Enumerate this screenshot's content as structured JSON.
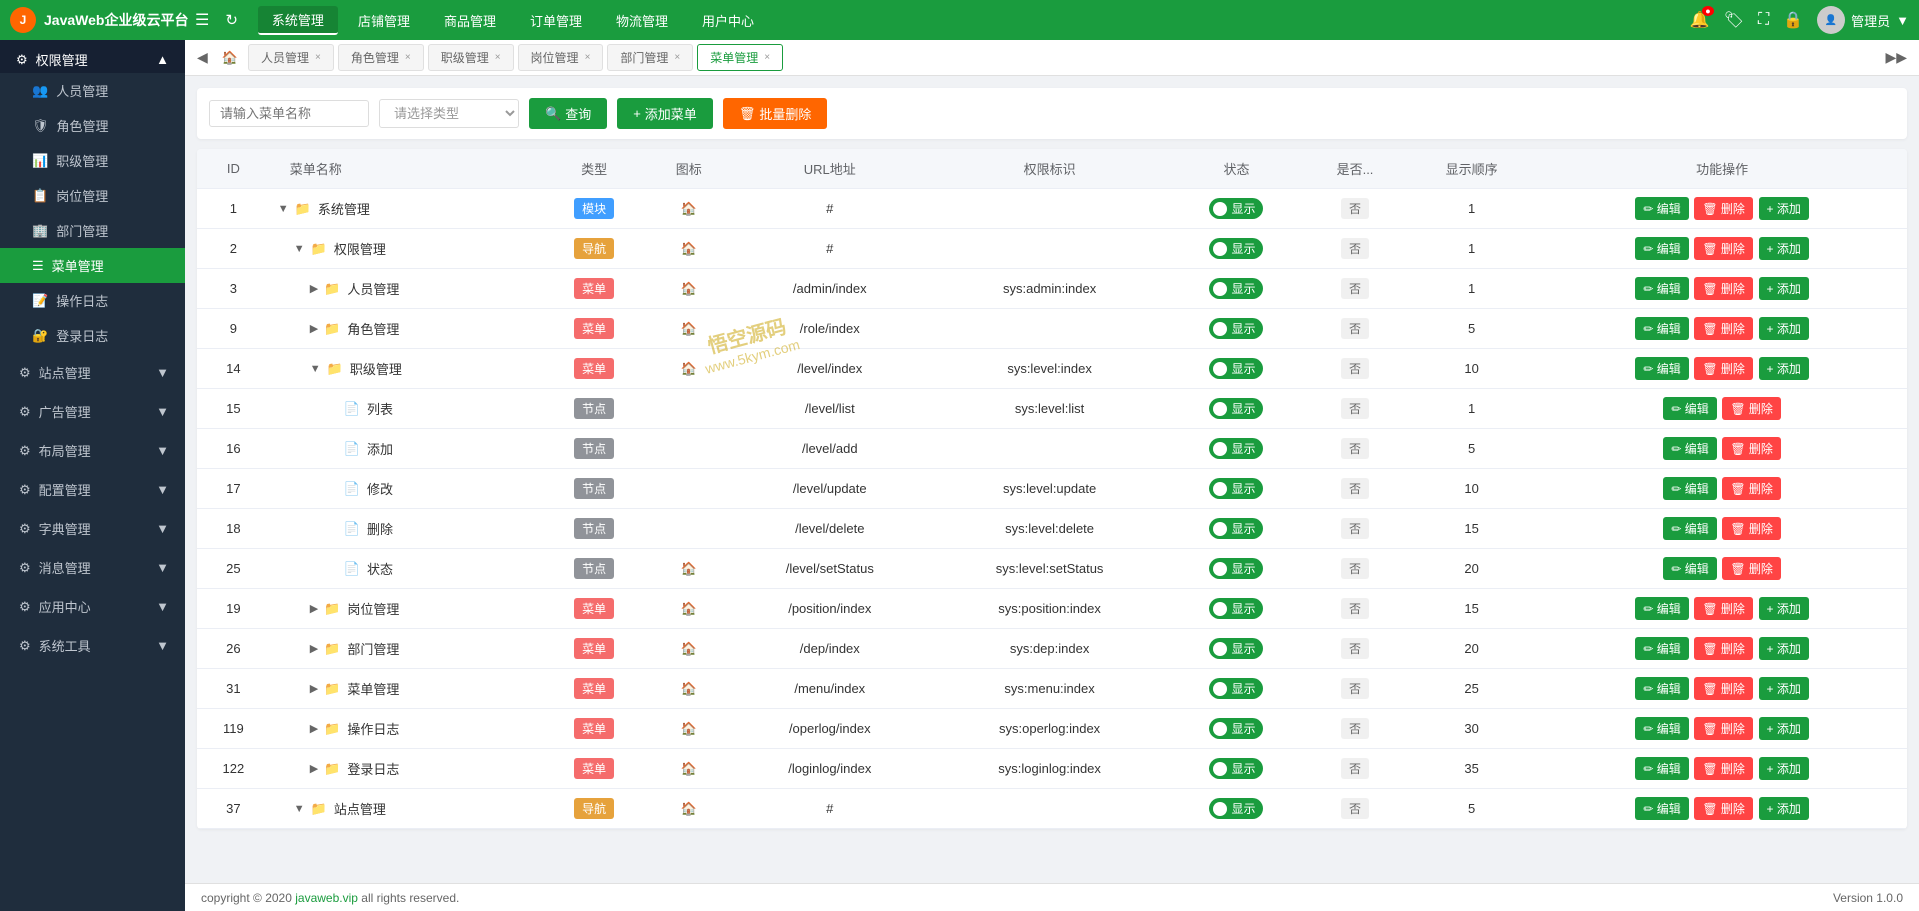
{
  "app": {
    "title": "JavaWeb企业级云平台",
    "version": "Version 1.0.0",
    "copyright": "copyright © 2020",
    "copyright_link": "javaweb.vip",
    "copyright_suffix": "all rights reserved."
  },
  "top_nav": {
    "menus": [
      {
        "label": "系统管理",
        "active": true
      },
      {
        "label": "店铺管理",
        "active": false
      },
      {
        "label": "商品管理",
        "active": false
      },
      {
        "label": "订单管理",
        "active": false
      },
      {
        "label": "物流管理",
        "active": false
      },
      {
        "label": "用户中心",
        "active": false
      }
    ],
    "admin_label": "管理员"
  },
  "sidebar": {
    "section_title": "权限管理",
    "items": [
      {
        "label": "人员管理",
        "active": false
      },
      {
        "label": "角色管理",
        "active": false
      },
      {
        "label": "职级管理",
        "active": false
      },
      {
        "label": "岗位管理",
        "active": false
      },
      {
        "label": "部门管理",
        "active": false
      },
      {
        "label": "菜单管理",
        "active": true
      },
      {
        "label": "操作日志",
        "active": false
      },
      {
        "label": "登录日志",
        "active": false
      }
    ],
    "sections": [
      {
        "label": "站点管理"
      },
      {
        "label": "广告管理"
      },
      {
        "label": "布局管理"
      },
      {
        "label": "配置管理"
      },
      {
        "label": "字典管理"
      },
      {
        "label": "消息管理"
      },
      {
        "label": "应用中心"
      },
      {
        "label": "系统工具"
      }
    ]
  },
  "tabs": [
    {
      "label": "人员管理",
      "active": false,
      "closable": true
    },
    {
      "label": "角色管理",
      "active": false,
      "closable": true
    },
    {
      "label": "职级管理",
      "active": false,
      "closable": true
    },
    {
      "label": "岗位管理",
      "active": false,
      "closable": true
    },
    {
      "label": "部门管理",
      "active": false,
      "closable": true
    },
    {
      "label": "菜单管理",
      "active": true,
      "closable": true
    }
  ],
  "filter": {
    "name_placeholder": "请输入菜单名称",
    "type_placeholder": "请选择类型",
    "search_btn": "查询",
    "add_btn": "添加菜单",
    "batch_delete_btn": "批量删除"
  },
  "table": {
    "columns": [
      "ID",
      "菜单名称",
      "类型",
      "图标",
      "URL地址",
      "权限标识",
      "状态",
      "是否...",
      "显示顺序",
      "功能操作"
    ],
    "rows": [
      {
        "id": "1",
        "name": "系统管理",
        "indent": 0,
        "expand": "collapse",
        "icon_type": "folder",
        "type": "模块",
        "type_class": "type-module",
        "has_icon": true,
        "url": "#",
        "perm": "",
        "status": "显示",
        "is_no": "否",
        "order": "1",
        "has_add": true
      },
      {
        "id": "2",
        "name": "权限管理",
        "indent": 1,
        "expand": "collapse",
        "icon_type": "folder",
        "type": "导航",
        "type_class": "type-nav",
        "has_icon": true,
        "url": "#",
        "perm": "",
        "status": "显示",
        "is_no": "否",
        "order": "1",
        "has_add": true
      },
      {
        "id": "3",
        "name": "人员管理",
        "indent": 2,
        "expand": "expand",
        "icon_type": "folder",
        "type": "菜单",
        "type_class": "type-menu",
        "has_icon": true,
        "url": "/admin/index",
        "perm": "sys:admin:index",
        "status": "显示",
        "is_no": "否",
        "order": "1",
        "has_add": true
      },
      {
        "id": "9",
        "name": "角色管理",
        "indent": 2,
        "expand": "expand",
        "icon_type": "folder",
        "type": "菜单",
        "type_class": "type-menu",
        "has_icon": true,
        "url": "/role/index",
        "perm": "",
        "status": "显示",
        "is_no": "否",
        "order": "5",
        "has_add": true
      },
      {
        "id": "14",
        "name": "职级管理",
        "indent": 2,
        "expand": "collapse",
        "icon_type": "folder",
        "type": "菜单",
        "type_class": "type-menu",
        "has_icon": true,
        "url": "/level/index",
        "perm": "sys:level:index",
        "status": "显示",
        "is_no": "否",
        "order": "10",
        "has_add": true
      },
      {
        "id": "15",
        "name": "列表",
        "indent": 3,
        "expand": "none",
        "icon_type": "file",
        "type": "节点",
        "type_class": "type-node",
        "has_icon": false,
        "url": "/level/list",
        "perm": "sys:level:list",
        "status": "显示",
        "is_no": "否",
        "order": "1",
        "has_add": false
      },
      {
        "id": "16",
        "name": "添加",
        "indent": 3,
        "expand": "none",
        "icon_type": "file",
        "type": "节点",
        "type_class": "type-node",
        "has_icon": false,
        "url": "/level/add",
        "perm": "",
        "status": "显示",
        "is_no": "否",
        "order": "5",
        "has_add": false
      },
      {
        "id": "17",
        "name": "修改",
        "indent": 3,
        "expand": "none",
        "icon_type": "file",
        "type": "节点",
        "type_class": "type-node",
        "has_icon": false,
        "url": "/level/update",
        "perm": "sys:level:update",
        "status": "显示",
        "is_no": "否",
        "order": "10",
        "has_add": false
      },
      {
        "id": "18",
        "name": "删除",
        "indent": 3,
        "expand": "none",
        "icon_type": "file",
        "type": "节点",
        "type_class": "type-node",
        "has_icon": false,
        "url": "/level/delete",
        "perm": "sys:level:delete",
        "status": "显示",
        "is_no": "否",
        "order": "15",
        "has_add": false
      },
      {
        "id": "25",
        "name": "状态",
        "indent": 3,
        "expand": "none",
        "icon_type": "file",
        "type": "节点",
        "type_class": "type-node",
        "has_icon": true,
        "url": "/level/setStatus",
        "perm": "sys:level:setStatus",
        "status": "显示",
        "is_no": "否",
        "order": "20",
        "has_add": false
      },
      {
        "id": "19",
        "name": "岗位管理",
        "indent": 2,
        "expand": "expand",
        "icon_type": "folder",
        "type": "菜单",
        "type_class": "type-menu",
        "has_icon": true,
        "url": "/position/index",
        "perm": "sys:position:index",
        "status": "显示",
        "is_no": "否",
        "order": "15",
        "has_add": true
      },
      {
        "id": "26",
        "name": "部门管理",
        "indent": 2,
        "expand": "expand",
        "icon_type": "folder",
        "type": "菜单",
        "type_class": "type-menu",
        "has_icon": true,
        "url": "/dep/index",
        "perm": "sys:dep:index",
        "status": "显示",
        "is_no": "否",
        "order": "20",
        "has_add": true
      },
      {
        "id": "31",
        "name": "菜单管理",
        "indent": 2,
        "expand": "expand",
        "icon_type": "folder",
        "type": "菜单",
        "type_class": "type-menu",
        "has_icon": true,
        "url": "/menu/index",
        "perm": "sys:menu:index",
        "status": "显示",
        "is_no": "否",
        "order": "25",
        "has_add": true
      },
      {
        "id": "119",
        "name": "操作日志",
        "indent": 2,
        "expand": "expand",
        "icon_type": "folder",
        "type": "菜单",
        "type_class": "type-menu",
        "has_icon": true,
        "url": "/operlog/index",
        "perm": "sys:operlog:index",
        "status": "显示",
        "is_no": "否",
        "order": "30",
        "has_add": true
      },
      {
        "id": "122",
        "name": "登录日志",
        "indent": 2,
        "expand": "expand",
        "icon_type": "folder",
        "type": "菜单",
        "type_class": "type-menu",
        "has_icon": true,
        "url": "/loginlog/index",
        "perm": "sys:loginlog:index",
        "status": "显示",
        "is_no": "否",
        "order": "35",
        "has_add": true
      },
      {
        "id": "37",
        "name": "站点管理",
        "indent": 1,
        "expand": "collapse",
        "icon_type": "folder",
        "type": "导航",
        "type_class": "type-nav",
        "has_icon": true,
        "url": "#",
        "perm": "",
        "status": "显示",
        "is_no": "否",
        "order": "5",
        "has_add": true
      }
    ]
  },
  "watermark": {
    "logo": "悟空源码",
    "url": "www.5kym.com"
  }
}
